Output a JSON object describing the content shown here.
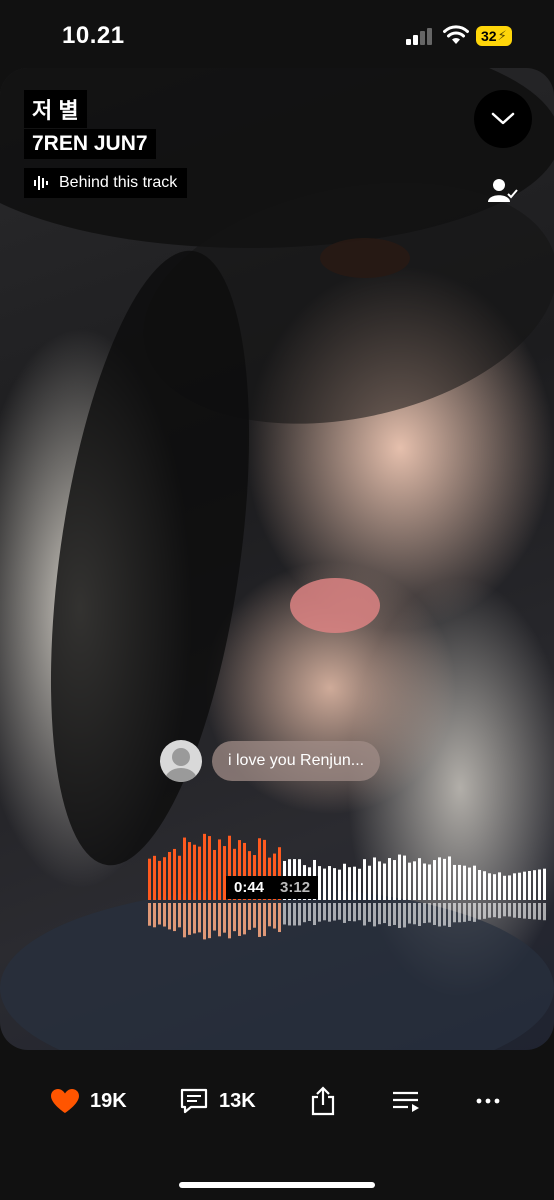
{
  "status_bar": {
    "time": "10.21",
    "battery": "32"
  },
  "track": {
    "title": "저 별",
    "artist": "7REN JUN7",
    "behind_label": "Behind this track"
  },
  "comment": {
    "text": "i love you Renjun..."
  },
  "player": {
    "current_time": "0:44",
    "duration": "3:12",
    "progress": 0.23
  },
  "actions": {
    "likes": "19K",
    "comments": "13K"
  },
  "colors": {
    "accent": "#ff5500",
    "played_bars": "#ff5a1f",
    "background": "#111111"
  },
  "icons": [
    "chevron-down-icon",
    "follow-icon",
    "waveform-icon",
    "heart-icon",
    "comment-icon",
    "share-icon",
    "queue-icon",
    "more-icon"
  ]
}
